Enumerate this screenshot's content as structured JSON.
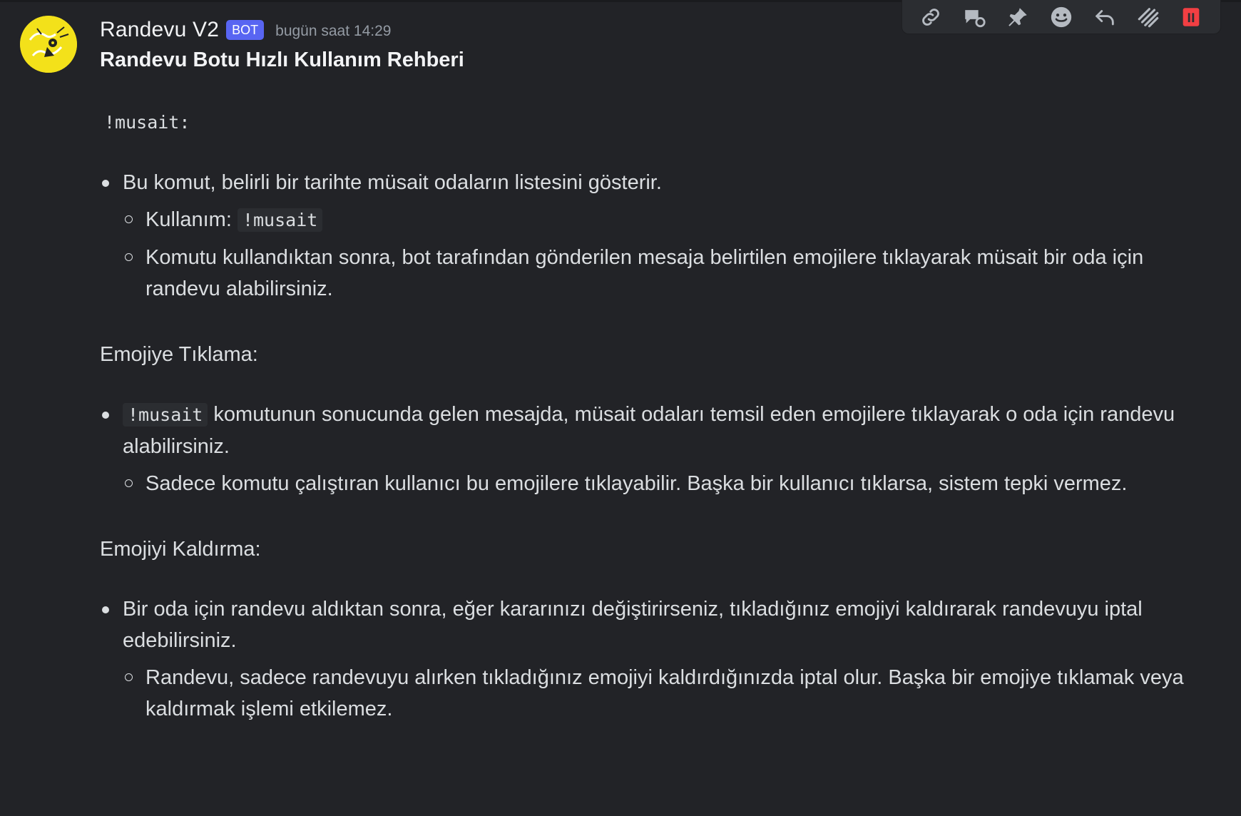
{
  "message": {
    "author": "Randevu V2",
    "badge": "BOT",
    "timestamp": "bugün saat 14:29",
    "avatar_label": "Randevu Bot",
    "title": "Randevu Botu Hızlı Kullanım Rehberi",
    "command_heading": "!musait:",
    "section1": {
      "bullet": "Bu komut, belirli bir tarihte müsait odaların listesini gösterir.",
      "sub1_label": "Kullanım:",
      "sub1_code": "!musait",
      "sub2": "Komutu kullandıktan sonra, bot tarafından gönderilen mesaja belirtilen emojilere tıklayarak müsait bir oda için randevu alabilirsiniz."
    },
    "section2": {
      "heading": "Emojiye Tıklama:",
      "bullet_code": "!musait",
      "bullet_text": "komutunun sonucunda gelen mesajda, müsait odaları temsil eden emojilere tıklayarak o oda için randevu alabilirsiniz.",
      "sub1": "Sadece komutu çalıştıran kullanıcı bu emojilere tıklayabilir. Başka bir kullanıcı tıklarsa, sistem tepki vermez."
    },
    "section3": {
      "heading": "Emojiyi Kaldırma:",
      "bullet": "Bir oda için randevu aldıktan sonra, eğer kararınızı değiştirirseniz, tıkladığınız emojiyi kaldırarak randevuyu iptal edebilirsiniz.",
      "sub1": "Randevu, sadece randevuyu alırken tıkladığınız emojiyi kaldırdığınızda iptal olur. Başka bir emojiye tıklamak veya kaldırmak işlemi etkilemez."
    }
  },
  "toolbar": {
    "icons": [
      "link-icon",
      "thread-icon",
      "pin-icon",
      "add-reaction-icon",
      "reply-icon",
      "apps-icon",
      "delete-icon"
    ]
  },
  "colors": {
    "background": "#222327",
    "badge": "#5865f2",
    "delete": "#f23f43",
    "avatar": "#f3e11a"
  }
}
